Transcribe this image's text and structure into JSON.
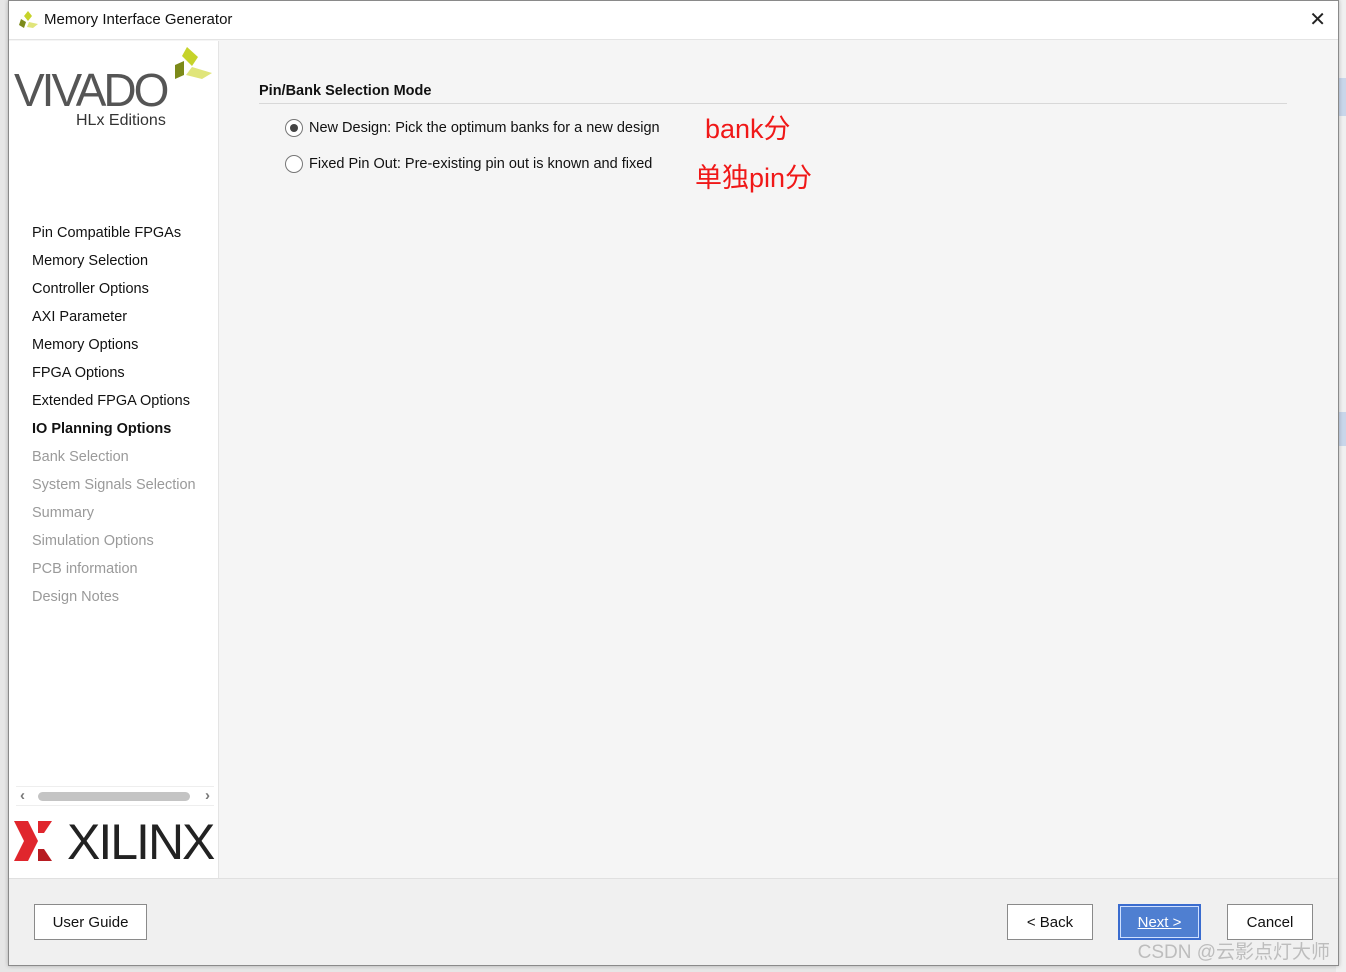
{
  "window": {
    "title": "Memory Interface Generator",
    "close_icon": "close-icon"
  },
  "sidebar": {
    "logo_top": "VIVADO",
    "logo_sub": "HLx Editions",
    "logo_bottom": "XILINX",
    "steps": [
      {
        "label": "Pin Compatible FPGAs",
        "state": "done"
      },
      {
        "label": "Memory Selection",
        "state": "done"
      },
      {
        "label": "Controller Options",
        "state": "done"
      },
      {
        "label": "AXI Parameter",
        "state": "done"
      },
      {
        "label": "Memory Options",
        "state": "done"
      },
      {
        "label": "FPGA Options",
        "state": "done"
      },
      {
        "label": "Extended FPGA Options",
        "state": "done"
      },
      {
        "label": "IO Planning Options",
        "state": "current"
      },
      {
        "label": "Bank Selection",
        "state": "disabled"
      },
      {
        "label": "System Signals Selection",
        "state": "disabled"
      },
      {
        "label": "Summary",
        "state": "disabled"
      },
      {
        "label": "Simulation Options",
        "state": "disabled"
      },
      {
        "label": "PCB information",
        "state": "disabled"
      },
      {
        "label": "Design Notes",
        "state": "disabled"
      }
    ]
  },
  "main": {
    "section_title": "Pin/Bank Selection Mode",
    "options": [
      {
        "label": "New Design: Pick the optimum banks for a new design",
        "selected": true
      },
      {
        "label": "Fixed Pin Out: Pre-existing pin out is known and fixed",
        "selected": false
      }
    ],
    "annotations": [
      "bank分",
      "单独pin分"
    ],
    "annotation_color": "#f01818"
  },
  "footer": {
    "user_guide": "User Guide",
    "back": "< Back",
    "next": "Next >",
    "cancel": "Cancel",
    "watermark": "CSDN @云影点灯大师"
  }
}
